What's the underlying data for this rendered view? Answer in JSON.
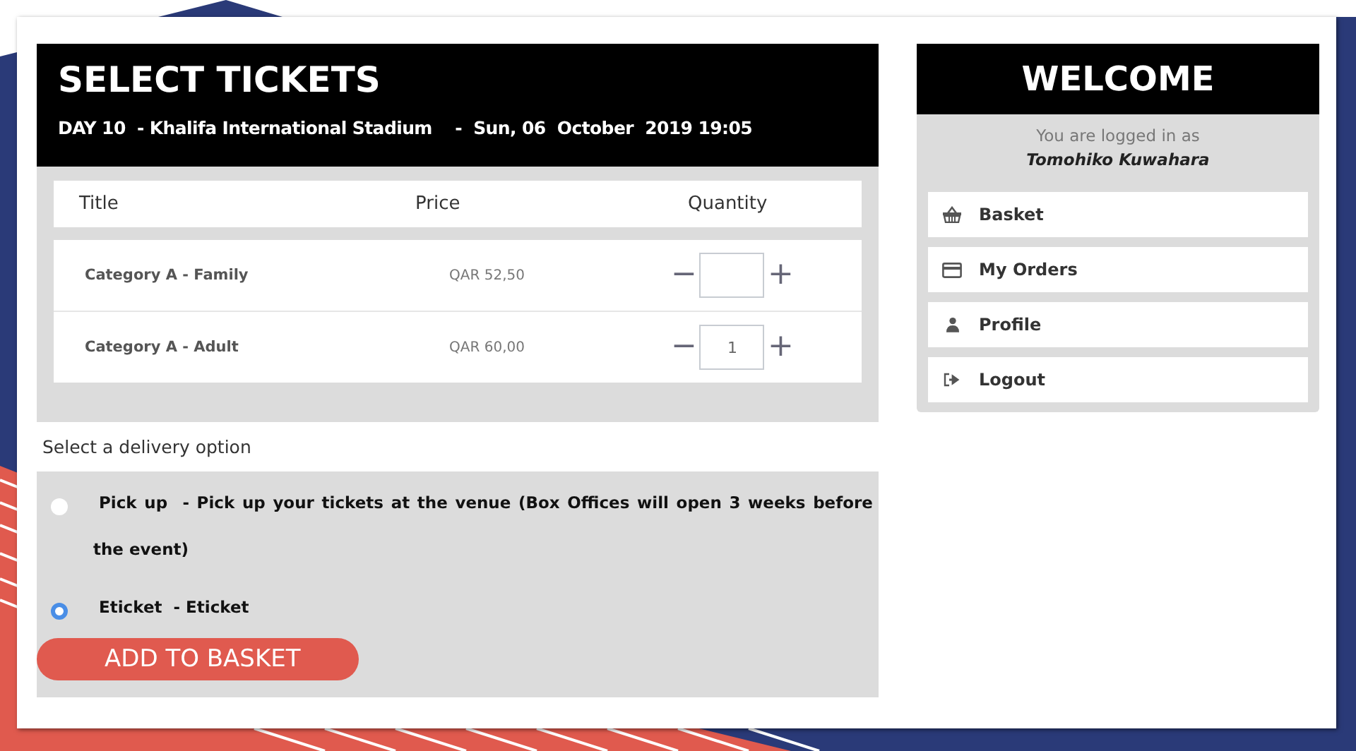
{
  "tickets": {
    "title": "SELECT TICKETS",
    "subtitle": "DAY 10  - Khalifa International Stadium    -  Sun, 06  October  2019 19:05",
    "columns": [
      "Title",
      "Price",
      "Quantity"
    ],
    "rows": [
      {
        "title": "Category A - Family",
        "price": "QAR 52,50",
        "minus": "−",
        "plus": "+"
      },
      {
        "title": "Category A - Adult",
        "price": "QAR 60,00",
        "quantity": "1",
        "minus": "−",
        "plus": "+"
      }
    ]
  },
  "delivery": {
    "label": "Select a delivery option",
    "options": [
      {
        "text": "Pick up  - Pick up your tickets at the venue (Box Offices will open 3 weeks before the event)",
        "selected": false
      },
      {
        "text": "Eticket  - Eticket",
        "selected": true
      }
    ],
    "button": "ADD TO BASKET"
  },
  "welcome": {
    "title": "WELCOME",
    "logged_in_as": "You are logged in as",
    "user": "Tomohiko Kuwahara",
    "menu": [
      {
        "kind": "basket",
        "label": "Basket"
      },
      {
        "kind": "card",
        "label": "My Orders"
      },
      {
        "kind": "person",
        "label": "Profile"
      },
      {
        "kind": "logout",
        "label": "Logout"
      }
    ]
  }
}
